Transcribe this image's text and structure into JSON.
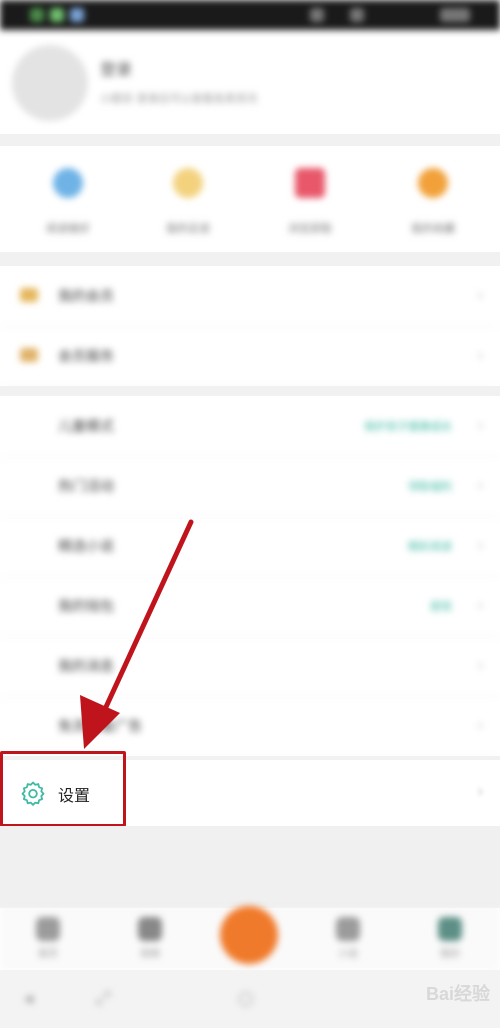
{
  "profile": {
    "name": "登录",
    "subtitle": "小题目 登录后可以查看各类资讯"
  },
  "quick_actions": [
    {
      "label": "阅读做好",
      "color": "#6fb3e6"
    },
    {
      "label": "我的足迹",
      "color": "#f3d27e"
    },
    {
      "label": "浏览获取",
      "color": "#e8586a"
    },
    {
      "label": "我的收藏",
      "color": "#f2a13a"
    }
  ],
  "menu_group1": [
    {
      "label": "我的会员"
    },
    {
      "label": "会员服务"
    }
  ],
  "menu_group2": [
    {
      "label": "儿童模式",
      "value": "保护孩子健康成长"
    },
    {
      "label": "热门活动",
      "value": "领取福利"
    },
    {
      "label": "精选小说",
      "value": "精彩阅读"
    },
    {
      "label": "我的钱包",
      "value": "提现"
    },
    {
      "label": "我的消息",
      "value": ""
    },
    {
      "label": "免流量看广告",
      "value": ""
    }
  ],
  "settings": {
    "label": "设置",
    "icon": "gear-icon"
  },
  "annotation": {
    "color": "#c0141d"
  },
  "tabs": [
    "首页",
    "视频",
    "",
    "小说",
    "我的"
  ],
  "watermark": "Bai经验"
}
